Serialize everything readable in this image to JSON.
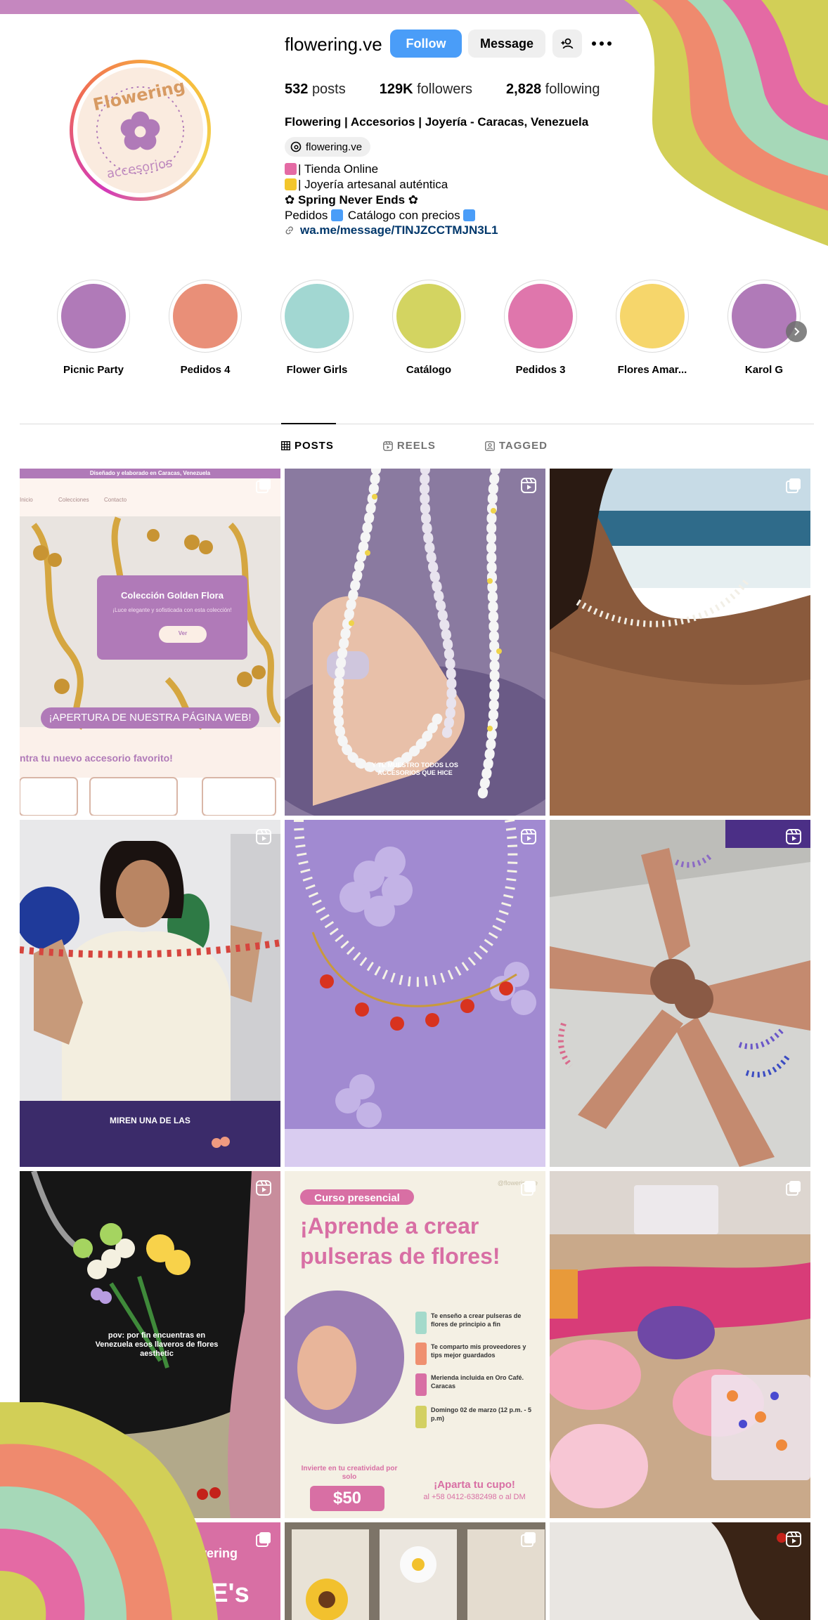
{
  "profile": {
    "username": "flowering.ve",
    "follow_label": "Follow",
    "message_label": "Message",
    "stats": {
      "posts_count": "532",
      "posts_label": "posts",
      "followers_count": "129K",
      "followers_label": "followers",
      "following_count": "2,828",
      "following_label": "following"
    },
    "bio_name": "Flowering | Accesorios | Joyería - Caracas, Venezuela",
    "threads_handle": "flowering.ve",
    "bio_lines": [
      "| Tienda Online",
      "| Joyería artesanal auténtica",
      "✿ Spring Never Ends ✿",
      "Pedidos",
      "Catálogo con precios"
    ],
    "link": "wa.me/message/TINJZCCTMJN3L1",
    "avatar_text_top": "Flowering",
    "avatar_text_bottom": "accesorios"
  },
  "highlights": [
    {
      "label": "Picnic Party",
      "color": "#b07ab8"
    },
    {
      "label": "Pedidos 4",
      "color": "#e98f78"
    },
    {
      "label": "Flower Girls",
      "color": "#a2d7d2"
    },
    {
      "label": "Catálogo",
      "color": "#d3d461"
    },
    {
      "label": "Pedidos 3",
      "color": "#df76ac"
    },
    {
      "label": "Flores Amar...",
      "color": "#f6d66b"
    },
    {
      "label": "Karol G",
      "color": "#b07ab8"
    }
  ],
  "tabs": {
    "posts": "POSTS",
    "reels": "REELS",
    "tagged": "TAGGED"
  },
  "posts": {
    "p1": {
      "top_bar": "Diseñado y elaborado en Caracas, Venezuela",
      "nav1": "Inicio",
      "nav2": "Colecciones",
      "nav3": "Contacto",
      "card_title": "Colección Golden Flora",
      "card_text": "¡Luce elegante y sofisticada con esta colección!",
      "card_btn": "Ver",
      "banner": "¡APERTURA DE NUESTRA PÁGINA WEB!",
      "footer": "ntra tu nuevo accesorio favorito!"
    },
    "p2": {
      "caption": "Y TE MUESTRO TODOS LOS ACCESORIOS QUE HICE"
    },
    "p4": {
      "caption": "MIREN UNA DE LAS"
    },
    "p7": {
      "caption": "pov: por fin encuentras en Venezuela esos llaveros de flores aesthetic"
    },
    "p8": {
      "pill": "Curso presencial",
      "handle": "@flowering.ve",
      "title1": "¡Aprende a crear",
      "title2": "pulseras de flores!",
      "items": [
        "Te enseño a crear pulseras de flores de principio a fin",
        "Te comparto mis proveedores y tips mejor guardados",
        "Merienda incluida en Oro Café. Caracas",
        "Domingo 02 de marzo (12 p.m. - 5 p.m)"
      ],
      "invest": "Invierte en tu creatividad por solo",
      "price": "$50",
      "cta": "¡Aparta tu cupo!",
      "contact": "al +58 0412-6382498 o al DM"
    },
    "p10": {
      "logo": "flowering",
      "big": "TINE's"
    }
  },
  "colors": {
    "brand_purple": "#c587bf",
    "follow_blue": "#4a9df8",
    "link_blue": "#00376b",
    "swirl_green": "#d2cf57",
    "swirl_salmon": "#ef8a6e",
    "swirl_mint": "#a6d8b8",
    "swirl_pink": "#e46aa4"
  }
}
